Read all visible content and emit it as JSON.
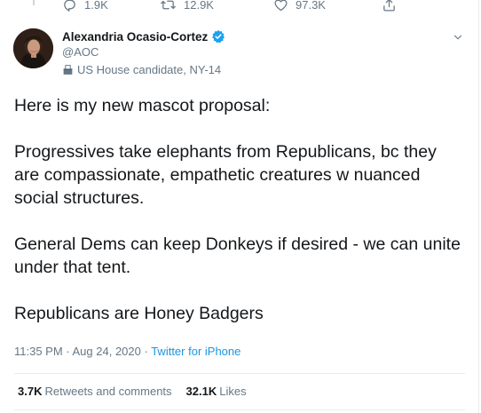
{
  "colors": {
    "text_primary": "#14171a",
    "text_secondary": "#657786",
    "link": "#1b95e0",
    "verified": "#1da1f2",
    "divider": "#e6ecf0"
  },
  "prev_tweet_actions": {
    "reply_icon": "reply-icon",
    "reply_count": "1.9K",
    "retweet_icon": "retweet-icon",
    "retweet_count": "12.9K",
    "like_icon": "heart-icon",
    "like_count": "97.3K",
    "share_icon": "share-icon"
  },
  "tweet": {
    "author": {
      "name": "Alexandria Ocasio-Cortez",
      "handle": "@AOC",
      "verified_icon": "verified-badge-icon",
      "label_icon": "ballot-box-icon",
      "label": "US House candidate, NY-14"
    },
    "menu_icon": "chevron-down-icon",
    "paragraphs": [
      "Here is my new mascot proposal:",
      "Progressives take elephants from Republicans, bc they are compassionate, empathetic creatures w nuanced social structures.",
      "General Dems can keep Donkeys if desired - we can unite under that tent.",
      "Republicans are Honey Badgers"
    ],
    "timestamp": "11:35 PM · Aug 24, 2020",
    "separator": " · ",
    "source": "Twitter for iPhone"
  },
  "stats": {
    "retweets_count": "3.7K",
    "retweets_label": "Retweets and comments",
    "likes_count": "32.1K",
    "likes_label": "Likes"
  }
}
